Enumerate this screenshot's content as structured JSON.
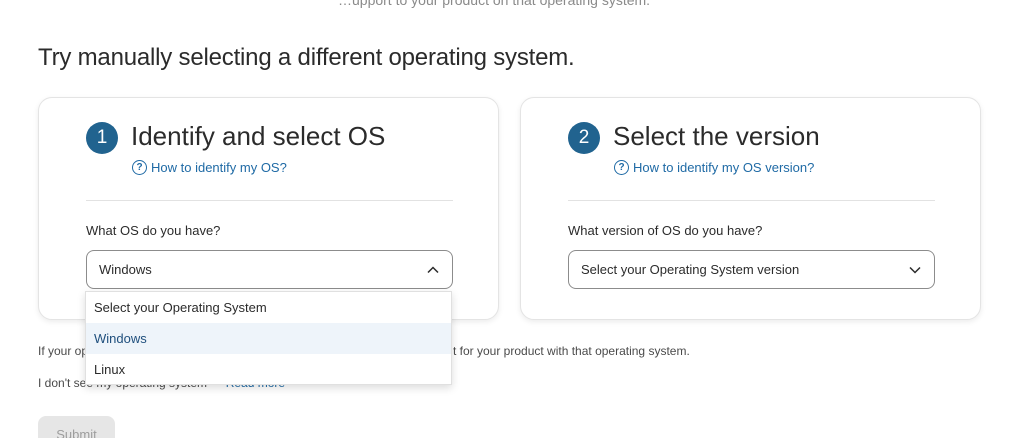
{
  "heading": "Try manually selecting a different operating system.",
  "top_fragment": "…upport to your product on that operating system.",
  "step1": {
    "number": "1",
    "title": "Identify and select OS",
    "help_link": "How to identify my OS?",
    "field_label": "What OS do you have?",
    "selected_value": "Windows",
    "options": [
      "Select your Operating System",
      "Windows",
      "Linux"
    ]
  },
  "step2": {
    "number": "2",
    "title": "Select the version",
    "help_link": "How to identify my OS version?",
    "field_label": "What version of OS do you have?",
    "placeholder": "Select your Operating System version"
  },
  "info_prefix": "If your op",
  "info_suffix": "t for your product with that operating system.",
  "dont_see": "I don't see my operating system",
  "read_more": "Read more",
  "submit_label": "Submit",
  "colors": {
    "accent": "#21638f",
    "link": "#1f6aa5"
  },
  "icons": {
    "help": "question-circle-icon",
    "collapse": "chevron-up-icon",
    "expand": "chevron-down-icon"
  }
}
